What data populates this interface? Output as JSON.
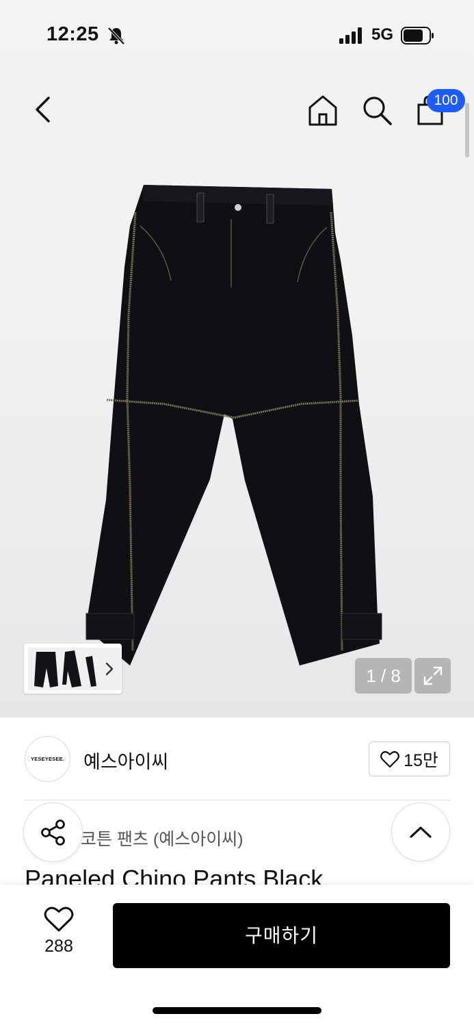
{
  "status_bar": {
    "time": "12:25",
    "network": "5G",
    "icons": [
      "bell-off-icon",
      "signal-icon",
      "battery-icon"
    ]
  },
  "top_nav": {
    "icons": [
      "back-icon",
      "home-icon",
      "search-icon",
      "cart-icon"
    ],
    "cart_badge": "100"
  },
  "gallery": {
    "current": 1,
    "total": 8,
    "counter_text": "1 / 8",
    "icons": [
      "chevron-right-icon",
      "fullscreen-icon"
    ]
  },
  "brand": {
    "logo_text": "YESEYESEE.",
    "name": "예스아이씨",
    "like_count": "15만"
  },
  "product": {
    "subtitle": "코튼 팬츠 (예스아이씨)",
    "title": "Paneled Chino Pants Black"
  },
  "bottom_bar": {
    "wish_count": "288",
    "buy_label": "구매하기"
  },
  "colors": {
    "badge": "#1f5cf5",
    "buy_button": "#000000",
    "stitch": "#7d7658"
  }
}
